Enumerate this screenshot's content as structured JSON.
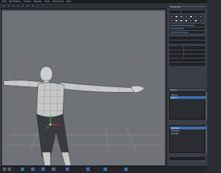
{
  "menu": {
    "items": [
      "Edit",
      "BuildMenu",
      "Create",
      "Display",
      "Tools",
      "Advanced",
      "Help"
    ]
  },
  "toolbar": {
    "icons": [
      "select-icon",
      "move-icon",
      "rotate-icon",
      "scale-icon",
      "camera-icon",
      "light-icon",
      "render-icon"
    ]
  },
  "viewport": {
    "object": "t-pose female mesh",
    "wire_color": "#2b2d31",
    "skin_color": "#c9c9c9",
    "pants_color": "#3a3b40",
    "axis_x_color": "#d23a3a",
    "axis_y_color": "#39c13c",
    "axis_z_color": "#3a67d6"
  },
  "panel": {
    "header_tab": "Properties",
    "list_tab": "Layers",
    "layer_items": [
      "Scene",
      "Figure"
    ],
    "bottom_items": [
      "Surface",
      "Shadow",
      "Render"
    ],
    "accent": "#3e6fb0"
  },
  "bottombar": {
    "icons": [
      "play-icon",
      "stop-icon",
      "record-icon",
      "key-icon",
      "grid-icon",
      "snap-icon",
      "wire-icon",
      "shade-icon",
      "zoom-icon",
      "pan-icon"
    ]
  }
}
